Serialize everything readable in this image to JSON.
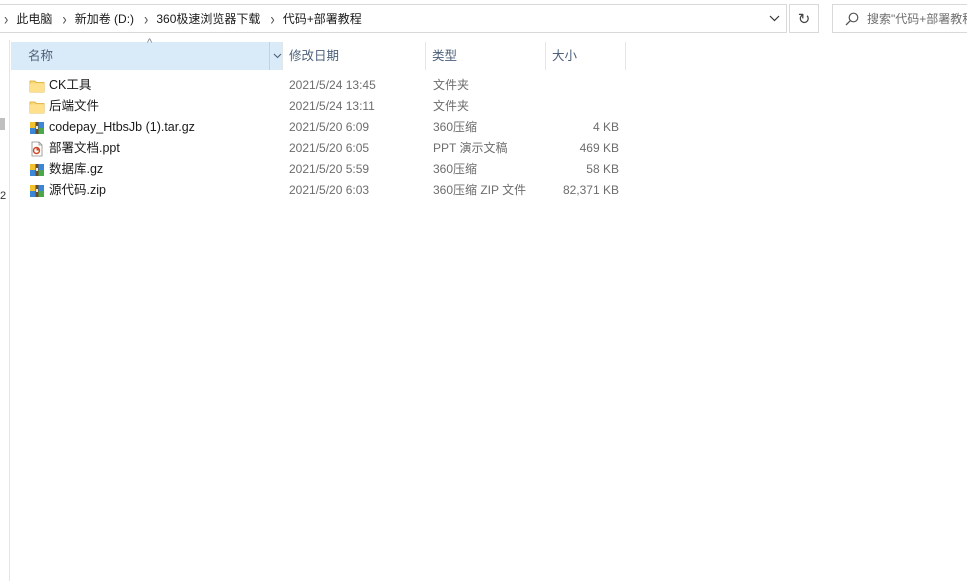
{
  "address_bar": {
    "breadcrumbs": [
      "此电脑",
      "新加卷 (D:)",
      "360极速浏览器下载",
      "代码+部署教程"
    ]
  },
  "search": {
    "placeholder": "搜索\"代码+部署教程\""
  },
  "columns": {
    "name": "名称",
    "date": "修改日期",
    "type": "类型",
    "size": "大小"
  },
  "sort": {
    "column": "name",
    "direction": "ascending"
  },
  "files": [
    {
      "name": "CK工具",
      "date": "2021/5/24 13:45",
      "type": "文件夹",
      "size": "",
      "icon": "folder-icon"
    },
    {
      "name": "后端文件",
      "date": "2021/5/24 13:11",
      "type": "文件夹",
      "size": "",
      "icon": "folder-icon"
    },
    {
      "name": "codepay_HtbsJb (1).tar.gz",
      "date": "2021/5/20 6:09",
      "type": "360压缩",
      "size": "4 KB",
      "icon": "archive-icon"
    },
    {
      "name": "部署文档.ppt",
      "date": "2021/5/20 6:05",
      "type": "PPT 演示文稿",
      "size": "469 KB",
      "icon": "ppt-icon"
    },
    {
      "name": "数据库.gz",
      "date": "2021/5/20 5:59",
      "type": "360压缩",
      "size": "58 KB",
      "icon": "archive-icon"
    },
    {
      "name": "源代码.zip",
      "date": "2021/5/20 6:03",
      "type": "360压缩 ZIP 文件",
      "size": "82,371 KB",
      "icon": "archive-icon"
    }
  ],
  "nav_pane": {
    "partial_text": "2"
  },
  "colors": {
    "header_selected_bg": "#d9ebf9",
    "header_text": "#4c607a",
    "folder_yellow": "#f8d775",
    "secondary_text": "#6d6d6d"
  }
}
